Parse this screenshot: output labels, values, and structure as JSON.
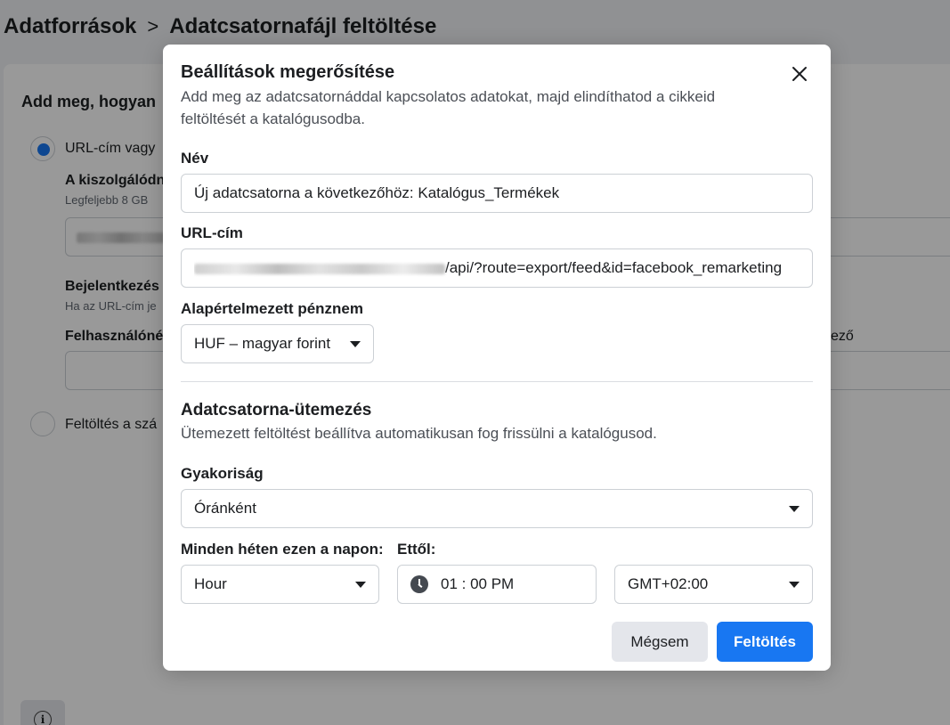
{
  "breadcrumb": {
    "root": "Adatforrások",
    "separator": ">",
    "current": "Adatcsatornafájl feltöltése"
  },
  "background": {
    "heading": "Add meg, hogyan",
    "option_url_label": "URL-cím vagy",
    "server_label": "A kiszolgálódn",
    "server_hint": "Legfeljebb 8 GB",
    "login_label": "Bejelentkezés",
    "login_hint": "Ha az URL-cím je",
    "username_label": "Felhasználóné",
    "password_label_fragment": "ező",
    "option_upload_label": "Feltöltés a szá",
    "info_icon": "i"
  },
  "modal": {
    "title": "Beállítások megerősítése",
    "description": "Add meg az adatcsatornáddal kapcsolatos adatokat, majd elindíthatod a cikkeid feltöltését a katalógusodba.",
    "name_label": "Név",
    "name_value": "Új adatcsatorna a következőhöz: Katalógus_Termékek",
    "url_label": "URL-cím",
    "url_value_suffix": "/api/?route=export/feed&id=facebook_remarketing",
    "currency_label": "Alapértelmezett pénznem",
    "currency_value": "HUF – magyar forint",
    "schedule_title": "Adatcsatorna-ütemezés",
    "schedule_desc": "Ütemezett feltöltést beállítva automatikusan fog frissülni a katalógusod.",
    "frequency_label": "Gyakoriság",
    "frequency_value": "Óránként",
    "weekday_label": "Minden héten ezen a napon:",
    "weekday_value": "Hour",
    "from_label": "Ettől:",
    "time_value": "01 : 00 PM",
    "timezone_value": "GMT+02:00",
    "cancel_label": "Mégsem",
    "upload_label": "Feltöltés"
  },
  "colors": {
    "primary": "#1877f2",
    "overlay": "rgba(0,0,0,0.4)"
  }
}
